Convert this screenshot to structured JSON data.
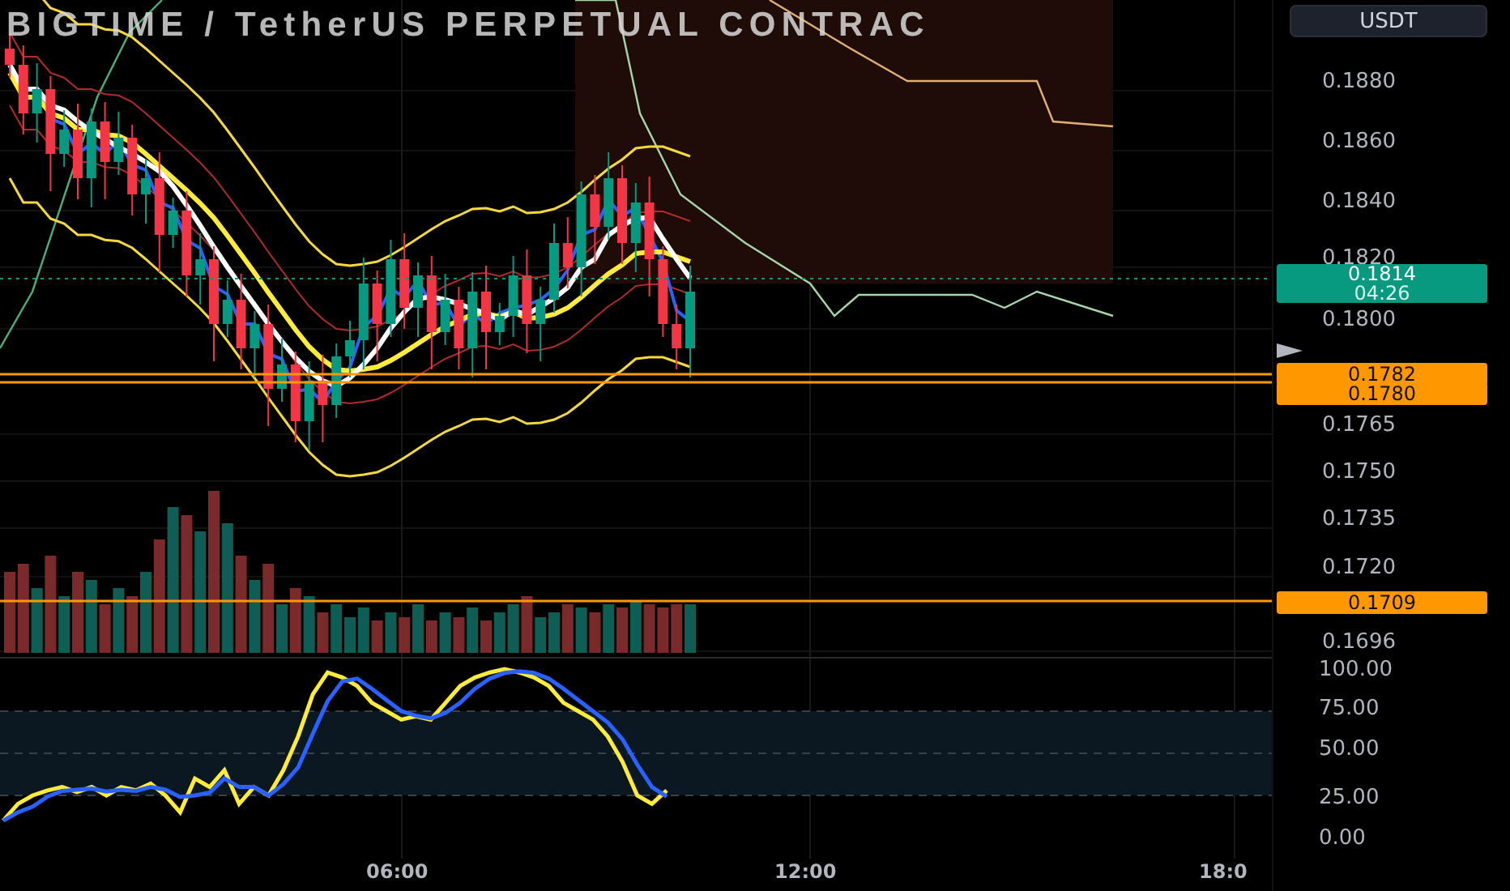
{
  "title": "BIGTIME / TetherUS PERPETUAL CONTRAC",
  "currency_button": "USDT",
  "price_axis": [
    "0.1880",
    "0.1860",
    "0.1840",
    "0.1820",
    "0.1800",
    "0.1765",
    "0.1750",
    "0.1735",
    "0.1720",
    "0.1696"
  ],
  "current_price": {
    "value": "0.1814",
    "countdown": "04:26"
  },
  "price_lines": [
    {
      "kind": "alert",
      "label": "0.1782"
    },
    {
      "kind": "alert",
      "label": "0.1780"
    },
    {
      "kind": "alert",
      "label": "0.1709"
    }
  ],
  "oscillator_axis": [
    "100.00",
    "75.00",
    "50.00",
    "25.00",
    "0.00"
  ],
  "time_axis": [
    "06:00",
    "12:00",
    "18:0"
  ]
}
